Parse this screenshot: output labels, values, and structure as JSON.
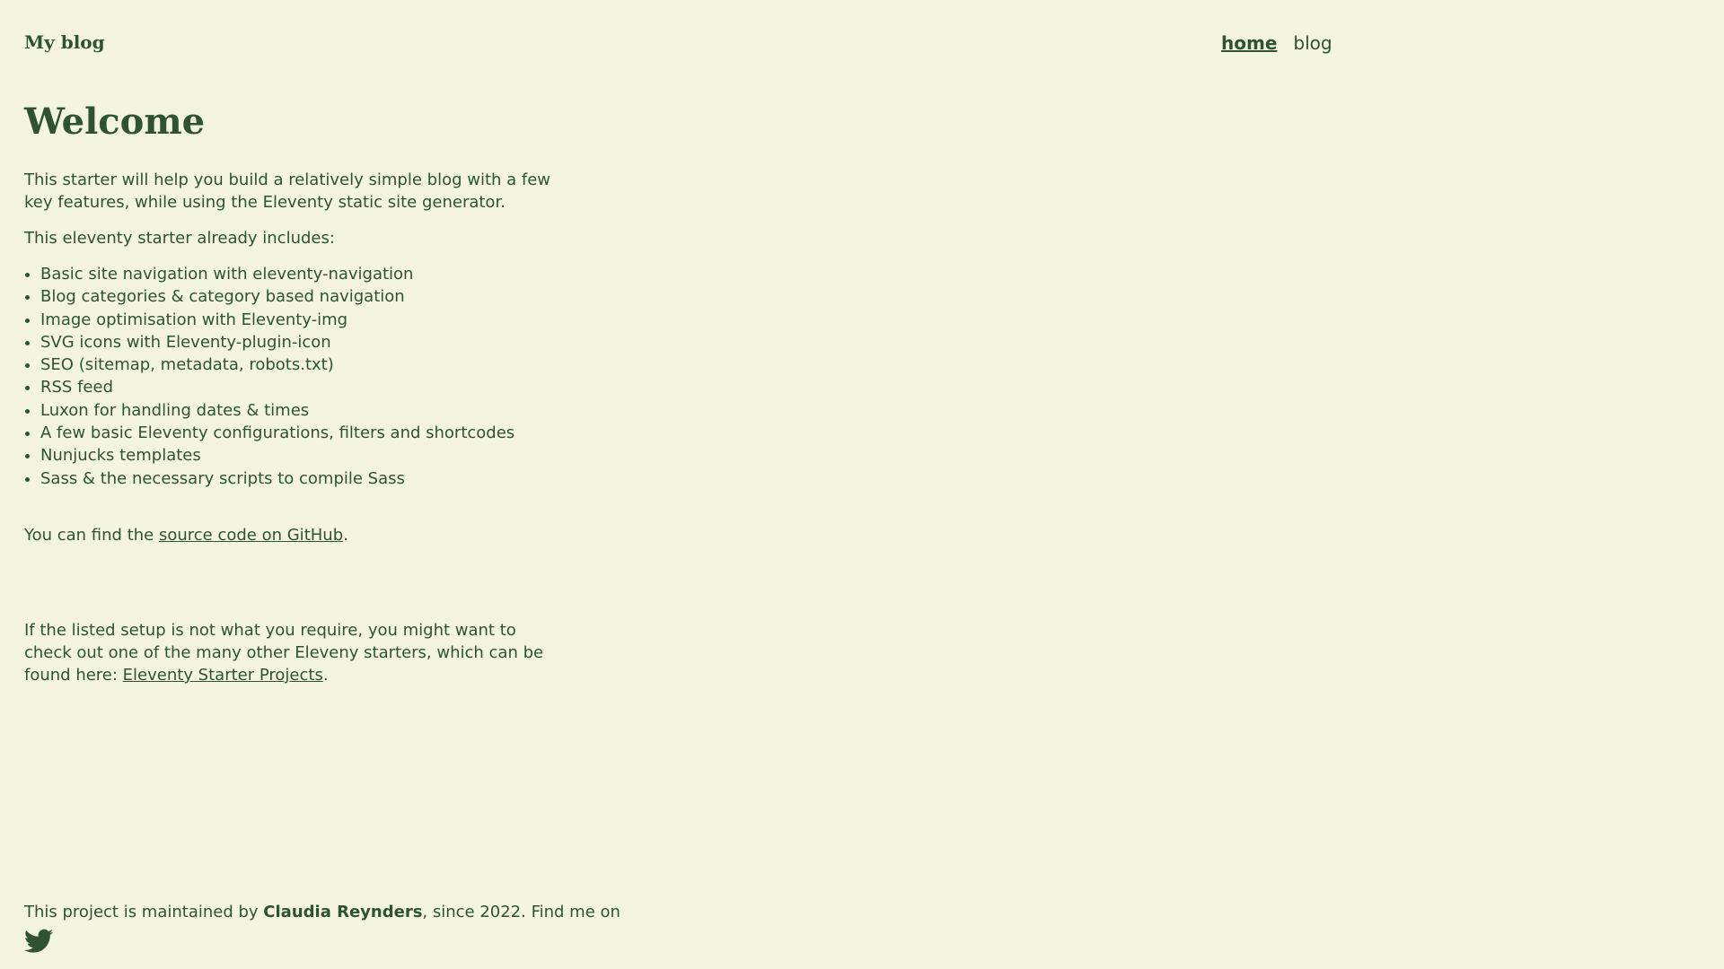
{
  "header": {
    "site_title": "My blog",
    "nav": [
      {
        "label": "home",
        "active": true
      },
      {
        "label": "blog",
        "active": false
      }
    ]
  },
  "main": {
    "title": "Welcome",
    "intro": "This starter will help you build a relatively simple blog with a few key features, while using the Eleventy static site generator.",
    "includes_heading": "This eleventy starter already includes:",
    "features": [
      "Basic site navigation with eleventy-navigation",
      "Blog categories & category based navigation",
      "Image optimisation with Eleventy-img",
      "SVG icons with Eleventy-plugin-icon",
      "SEO (sitemap, metadata, robots.txt)",
      "RSS feed",
      "Luxon for handling dates & times",
      "A few basic Eleventy configurations, filters and shortcodes",
      "Nunjucks templates",
      "Sass & the necessary scripts to compile Sass"
    ],
    "source_prefix": "You can find the ",
    "source_link": "source code on GitHub",
    "source_suffix": ".",
    "other_text": "If the listed setup is not what you require, you might want to check out one of the many other Eleveny starters, which can be found here: ",
    "other_link": "Eleventy Starter Projects",
    "other_suffix": "."
  },
  "footer": {
    "prefix": "This project is maintained by ",
    "author": "Claudia Reynders",
    "suffix": ", since 2022.  Find me on",
    "social_icon": "twitter-icon"
  },
  "colors": {
    "background": "#f3f5df",
    "text": "#2f5233"
  }
}
